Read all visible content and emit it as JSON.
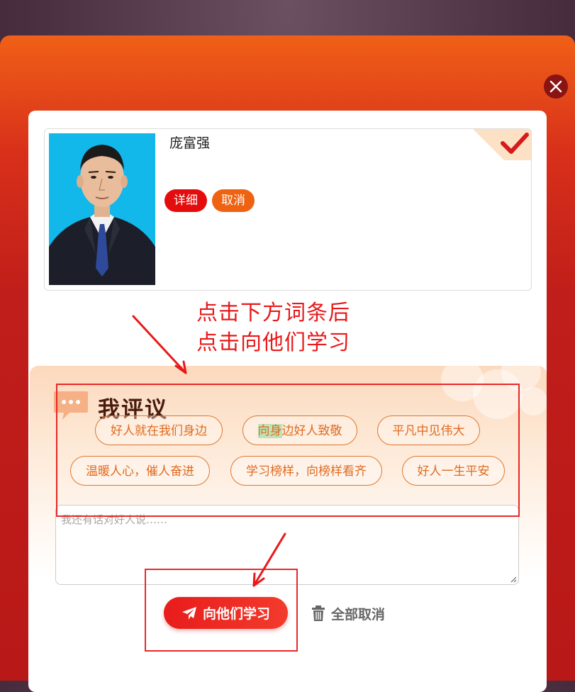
{
  "person": {
    "name": "庞富强",
    "detail_label": "详细",
    "cancel_label": "取消"
  },
  "annotation": {
    "line1": "点击下方词条后",
    "line2": "点击向他们学习"
  },
  "comment": {
    "title": "我评议",
    "tags_row1": [
      "好人就在我们身边",
      "向身边好人致敬",
      "平凡中见伟大"
    ],
    "tags_row2": [
      "温暖人心，催人奋进",
      "学习榜样，向榜样看齐",
      "好人一生平安"
    ],
    "highlight_prefix": "向身",
    "highlight_rest": "边好人致敬",
    "placeholder": "我还有话对好人说……"
  },
  "actions": {
    "study_label": "向他们学习",
    "clear_label": "全部取消"
  },
  "colors": {
    "accent_red": "#e40c0c",
    "accent_orange": "#ee6212",
    "tag_orange": "#e06a1f",
    "annotation_red": "#e8191a"
  }
}
